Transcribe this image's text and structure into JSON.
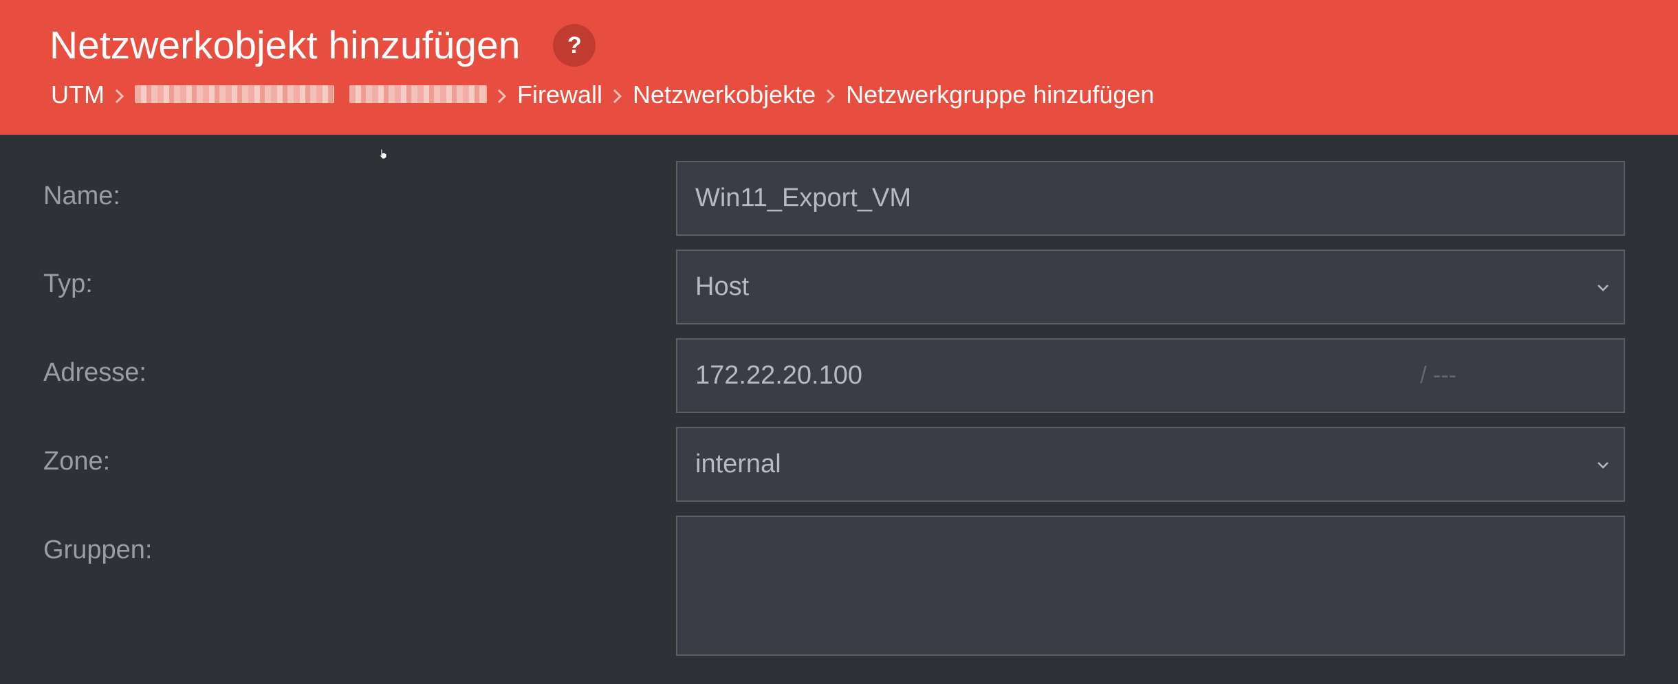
{
  "header": {
    "title": "Netzwerkobjekt hinzufügen",
    "help_label": "?",
    "breadcrumb": [
      "UTM",
      "Firewall",
      "Netzwerkobjekte",
      "Netzwerkgruppe hinzufügen"
    ]
  },
  "form": {
    "name": {
      "label": "Name:",
      "value": "Win11_Export_VM"
    },
    "typ": {
      "label": "Typ:",
      "value": "Host"
    },
    "adresse": {
      "label": "Adresse:",
      "value": "172.22.20.100",
      "prefix_placeholder": "/ ---"
    },
    "zone": {
      "label": "Zone:",
      "value": "internal"
    },
    "gruppen": {
      "label": "Gruppen:",
      "value": ""
    }
  },
  "colors": {
    "header_bg": "#e84e3f",
    "page_bg": "#2e3136",
    "field_bg": "#3a3d46",
    "field_border": "#5b5f67",
    "label_text": "#9a9ea4"
  }
}
